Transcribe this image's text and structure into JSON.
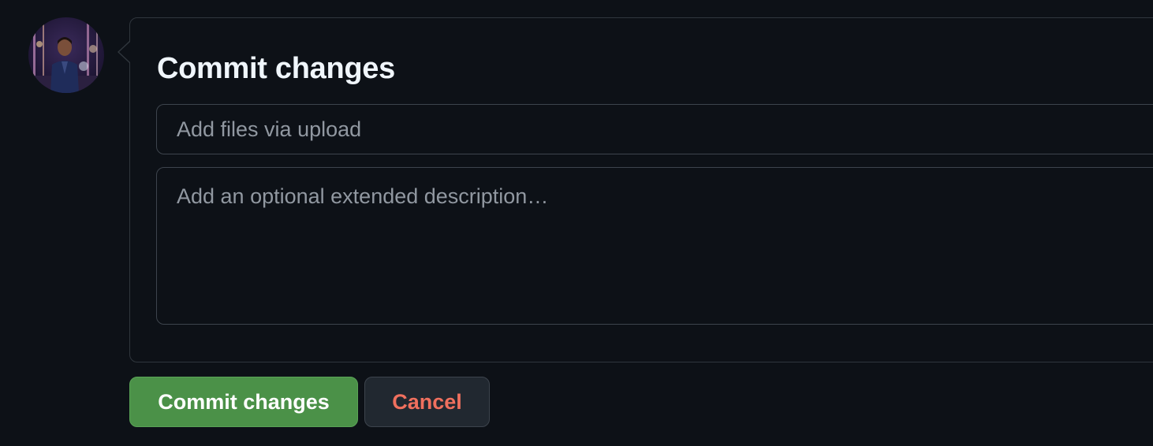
{
  "form": {
    "title": "Commit changes",
    "summary_placeholder": "Add files via upload",
    "summary_value": "",
    "description_placeholder": "Add an optional extended description…",
    "description_value": ""
  },
  "actions": {
    "commit_label": "Commit changes",
    "cancel_label": "Cancel"
  },
  "colors": {
    "background": "#0d1117",
    "commit_button": "#4b9148",
    "cancel_text": "#f0705e"
  }
}
